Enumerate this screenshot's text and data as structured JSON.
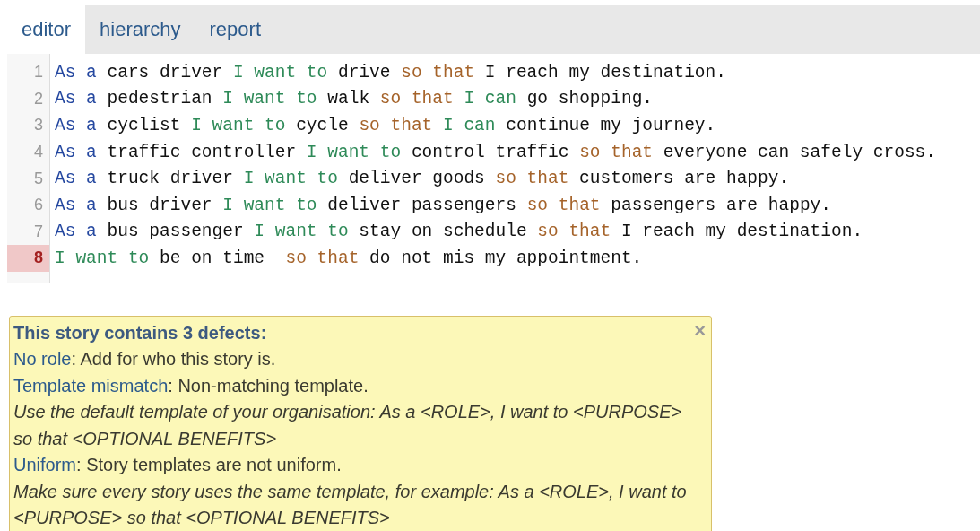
{
  "tabs": [
    {
      "label": "editor",
      "selected": true
    },
    {
      "label": "hierarchy",
      "selected": false
    },
    {
      "label": "report",
      "selected": false
    }
  ],
  "editor": {
    "lines": [
      {
        "number": "1",
        "error": false,
        "tokens": [
          {
            "kind": "role",
            "text": "As a"
          },
          {
            "kind": "plain",
            "text": " cars driver "
          },
          {
            "kind": "means",
            "text": "I want to"
          },
          {
            "kind": "plain",
            "text": " drive "
          },
          {
            "kind": "ends",
            "text": "so that"
          },
          {
            "kind": "plain",
            "text": " I reach my destination."
          }
        ]
      },
      {
        "number": "2",
        "error": false,
        "tokens": [
          {
            "kind": "role",
            "text": "As a"
          },
          {
            "kind": "plain",
            "text": " pedestrian "
          },
          {
            "kind": "means",
            "text": "I want to"
          },
          {
            "kind": "plain",
            "text": " walk "
          },
          {
            "kind": "ends",
            "text": "so that "
          },
          {
            "kind": "means",
            "text": "I can"
          },
          {
            "kind": "plain",
            "text": " go shopping."
          }
        ]
      },
      {
        "number": "3",
        "error": false,
        "tokens": [
          {
            "kind": "role",
            "text": "As a"
          },
          {
            "kind": "plain",
            "text": " cyclist "
          },
          {
            "kind": "means",
            "text": "I want to"
          },
          {
            "kind": "plain",
            "text": " cycle "
          },
          {
            "kind": "ends",
            "text": "so that "
          },
          {
            "kind": "means",
            "text": "I can"
          },
          {
            "kind": "plain",
            "text": " continue my journey."
          }
        ]
      },
      {
        "number": "4",
        "error": false,
        "tokens": [
          {
            "kind": "role",
            "text": "As a"
          },
          {
            "kind": "plain",
            "text": " traffic controller "
          },
          {
            "kind": "means",
            "text": "I want to"
          },
          {
            "kind": "plain",
            "text": " control traffic "
          },
          {
            "kind": "ends",
            "text": "so that"
          },
          {
            "kind": "plain",
            "text": " everyone can safely cross."
          }
        ]
      },
      {
        "number": "5",
        "error": false,
        "tokens": [
          {
            "kind": "role",
            "text": "As a"
          },
          {
            "kind": "plain",
            "text": " truck driver "
          },
          {
            "kind": "means",
            "text": "I want to"
          },
          {
            "kind": "plain",
            "text": " deliver goods "
          },
          {
            "kind": "ends",
            "text": "so that"
          },
          {
            "kind": "plain",
            "text": " customers are happy."
          }
        ]
      },
      {
        "number": "6",
        "error": false,
        "tokens": [
          {
            "kind": "role",
            "text": "As a"
          },
          {
            "kind": "plain",
            "text": " bus driver "
          },
          {
            "kind": "means",
            "text": "I want to"
          },
          {
            "kind": "plain",
            "text": " deliver passengers "
          },
          {
            "kind": "ends",
            "text": "so that"
          },
          {
            "kind": "plain",
            "text": " passengers are happy."
          }
        ]
      },
      {
        "number": "7",
        "error": false,
        "tokens": [
          {
            "kind": "role",
            "text": "As a"
          },
          {
            "kind": "plain",
            "text": " bus passenger "
          },
          {
            "kind": "means",
            "text": "I want to"
          },
          {
            "kind": "plain",
            "text": " stay on schedule "
          },
          {
            "kind": "ends",
            "text": "so that"
          },
          {
            "kind": "plain",
            "text": " I reach my destination."
          }
        ]
      },
      {
        "number": "8",
        "error": true,
        "tokens": [
          {
            "kind": "means",
            "text": "I want to"
          },
          {
            "kind": "plain",
            "text": " be on time  "
          },
          {
            "kind": "ends",
            "text": "so that"
          },
          {
            "kind": "plain",
            "text": " do not mis my appointment."
          }
        ]
      }
    ]
  },
  "defects": {
    "title": "This story contains 3 defects:",
    "close": "×",
    "entries": [
      {
        "kind": "defect",
        "name": "No role",
        "text": ": Add for who this story is."
      },
      {
        "kind": "defect",
        "name": "Template mismatch",
        "text": ": Non-matching template."
      },
      {
        "kind": "hint",
        "text": "Use the default template of your organisation: As a <ROLE>, I want to <PURPOSE> so that <OPTIONAL BENEFITS>"
      },
      {
        "kind": "defect",
        "name": "Uniform",
        "text": ": Story templates are not uniform."
      },
      {
        "kind": "hint",
        "text": "Make sure every story uses the same template, for example: As a <ROLE>, I want to <PURPOSE> so that <OPTIONAL BENEFITS>"
      }
    ]
  }
}
